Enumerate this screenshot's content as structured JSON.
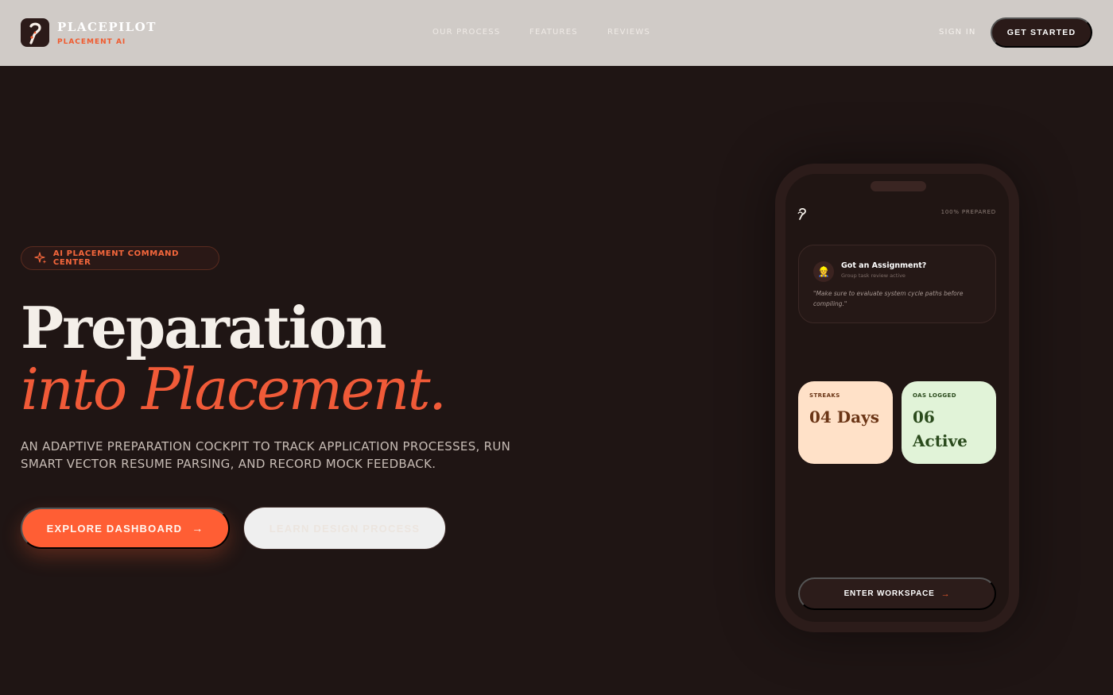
{
  "nav": {
    "brand_name": "PLACEPILOT",
    "brand_sub": "PLACEMENT AI",
    "links": [
      "OUR PROCESS",
      "FEATURES",
      "REVIEWS"
    ],
    "sign_in": "SIGN IN",
    "get_started": "GET STARTED",
    "logo_icon": "pilot-logo-icon"
  },
  "hero": {
    "badge": "AI PLACEMENT COMMAND CENTER",
    "badge_icon": "sparkle-icon",
    "title_line1": "Preparation",
    "title_line2": "into Placement.",
    "subtitle": "AN ADAPTIVE PREPARATION COCKPIT TO TRACK APPLICATION PROCESSES, RUN SMART VECTOR RESUME PARSING, AND RECORD MOCK FEEDBACK.",
    "primary_button": "EXPLORE DASHBOARD",
    "primary_arrow": "→",
    "secondary_button": "LEARN DESIGN PROCESS"
  },
  "phone": {
    "prepared": "100% PREPARED",
    "assignment": {
      "title": "Got an Assignment?",
      "subtitle": "Group task review active",
      "quote": "\"Make sure to evaluate system cycle paths before compiling.\"",
      "avatar_glyph": "👷"
    },
    "streaks": {
      "label": "STREAKS",
      "value": "04 Days"
    },
    "oas": {
      "label": "OAS LOGGED",
      "value": "06 Active"
    },
    "enter_button": "ENTER WORKSPACE",
    "enter_arrow": "→"
  },
  "colors": {
    "accent": "#ff5e34",
    "background": "#1f1514",
    "nav_bg": "#d0cbc7",
    "streaks_card": "#ffe1c8",
    "oas_card": "#e1f3d8"
  }
}
